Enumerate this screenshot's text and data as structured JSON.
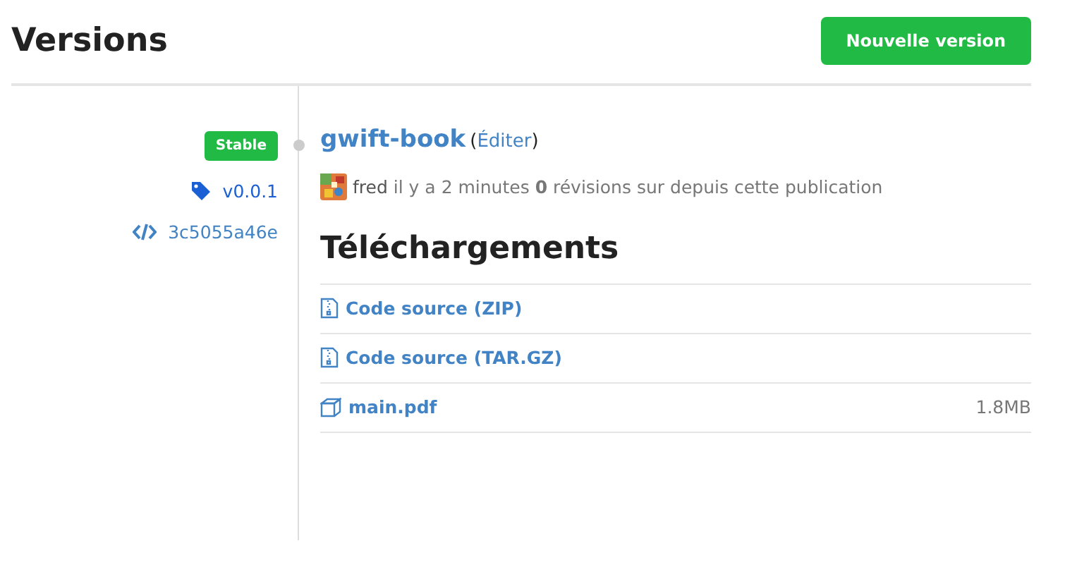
{
  "page": {
    "title": "Versions",
    "new_button": "Nouvelle version"
  },
  "release": {
    "badge": "Stable",
    "tag": "v0.0.1",
    "commit": "3c5055a46e",
    "name": "gwift-book",
    "edit_open": "(",
    "edit_label": "Éditer",
    "edit_close": ")",
    "author": "fred",
    "meta": "il y a 2 minutes **0** révisions sur depuis cette publication"
  },
  "downloads": {
    "title": "Téléchargements",
    "items": [
      {
        "kind": "archive",
        "label": "Code source (ZIP)"
      },
      {
        "kind": "archive",
        "label": "Code source (TAR.GZ)"
      },
      {
        "kind": "package",
        "label": "main.pdf",
        "size": "1.8MB"
      }
    ]
  }
}
